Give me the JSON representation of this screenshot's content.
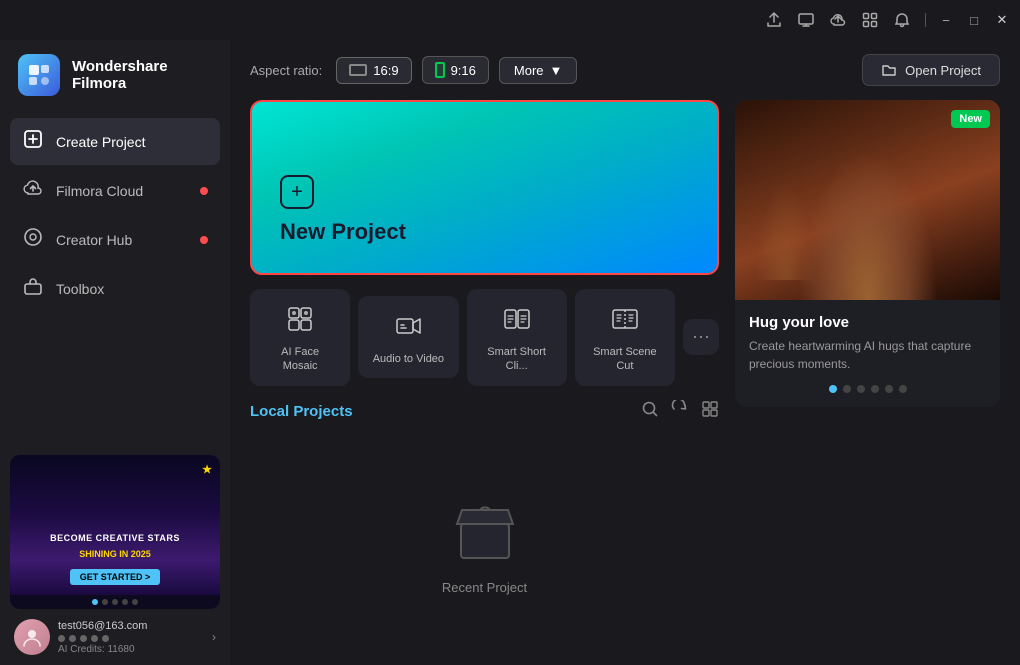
{
  "app": {
    "brand": "Wondershare",
    "product": "Filmora"
  },
  "titlebar": {
    "icons": [
      "share-icon",
      "monitor-icon",
      "cloud-upload-icon",
      "grid-icon",
      "bell-icon"
    ],
    "window_controls": [
      "minimize-button",
      "maximize-button",
      "close-button"
    ]
  },
  "sidebar": {
    "nav_items": [
      {
        "id": "create-project",
        "label": "Create Project",
        "active": true,
        "dot": false
      },
      {
        "id": "filmora-cloud",
        "label": "Filmora Cloud",
        "active": false,
        "dot": true
      },
      {
        "id": "creator-hub",
        "label": "Creator Hub",
        "active": false,
        "dot": true
      },
      {
        "id": "toolbox",
        "label": "Toolbox",
        "active": false,
        "dot": false
      }
    ],
    "banner": {
      "line1": "BECOME CREATIVE STARS",
      "line2": "SHINING IN 2025",
      "button": "GET STARTED >"
    },
    "dots": [
      true,
      false,
      false,
      false,
      false
    ]
  },
  "user": {
    "email": "test056@163.com",
    "credits_label": "AI Credits: 11680"
  },
  "topbar": {
    "aspect_label": "Aspect ratio:",
    "aspect_16_9": "16:9",
    "aspect_9_16": "9:16",
    "more_label": "More",
    "open_project_label": "Open Project"
  },
  "new_project": {
    "label": "New Project"
  },
  "quick_actions": [
    {
      "id": "ai-face-mosaic",
      "label": "AI Face Mosaic"
    },
    {
      "id": "audio-to-video",
      "label": "Audio to Video"
    },
    {
      "id": "smart-short-cli",
      "label": "Smart Short Cli..."
    },
    {
      "id": "smart-scene-cut",
      "label": "Smart Scene Cut"
    }
  ],
  "local_projects": {
    "title": "Local Projects",
    "empty_text": "Recent Project"
  },
  "promo": {
    "badge": "New",
    "title": "Hug your love",
    "description": "Create heartwarming AI hugs that capture precious moments.",
    "dots": [
      true,
      false,
      false,
      false,
      false,
      false
    ]
  }
}
